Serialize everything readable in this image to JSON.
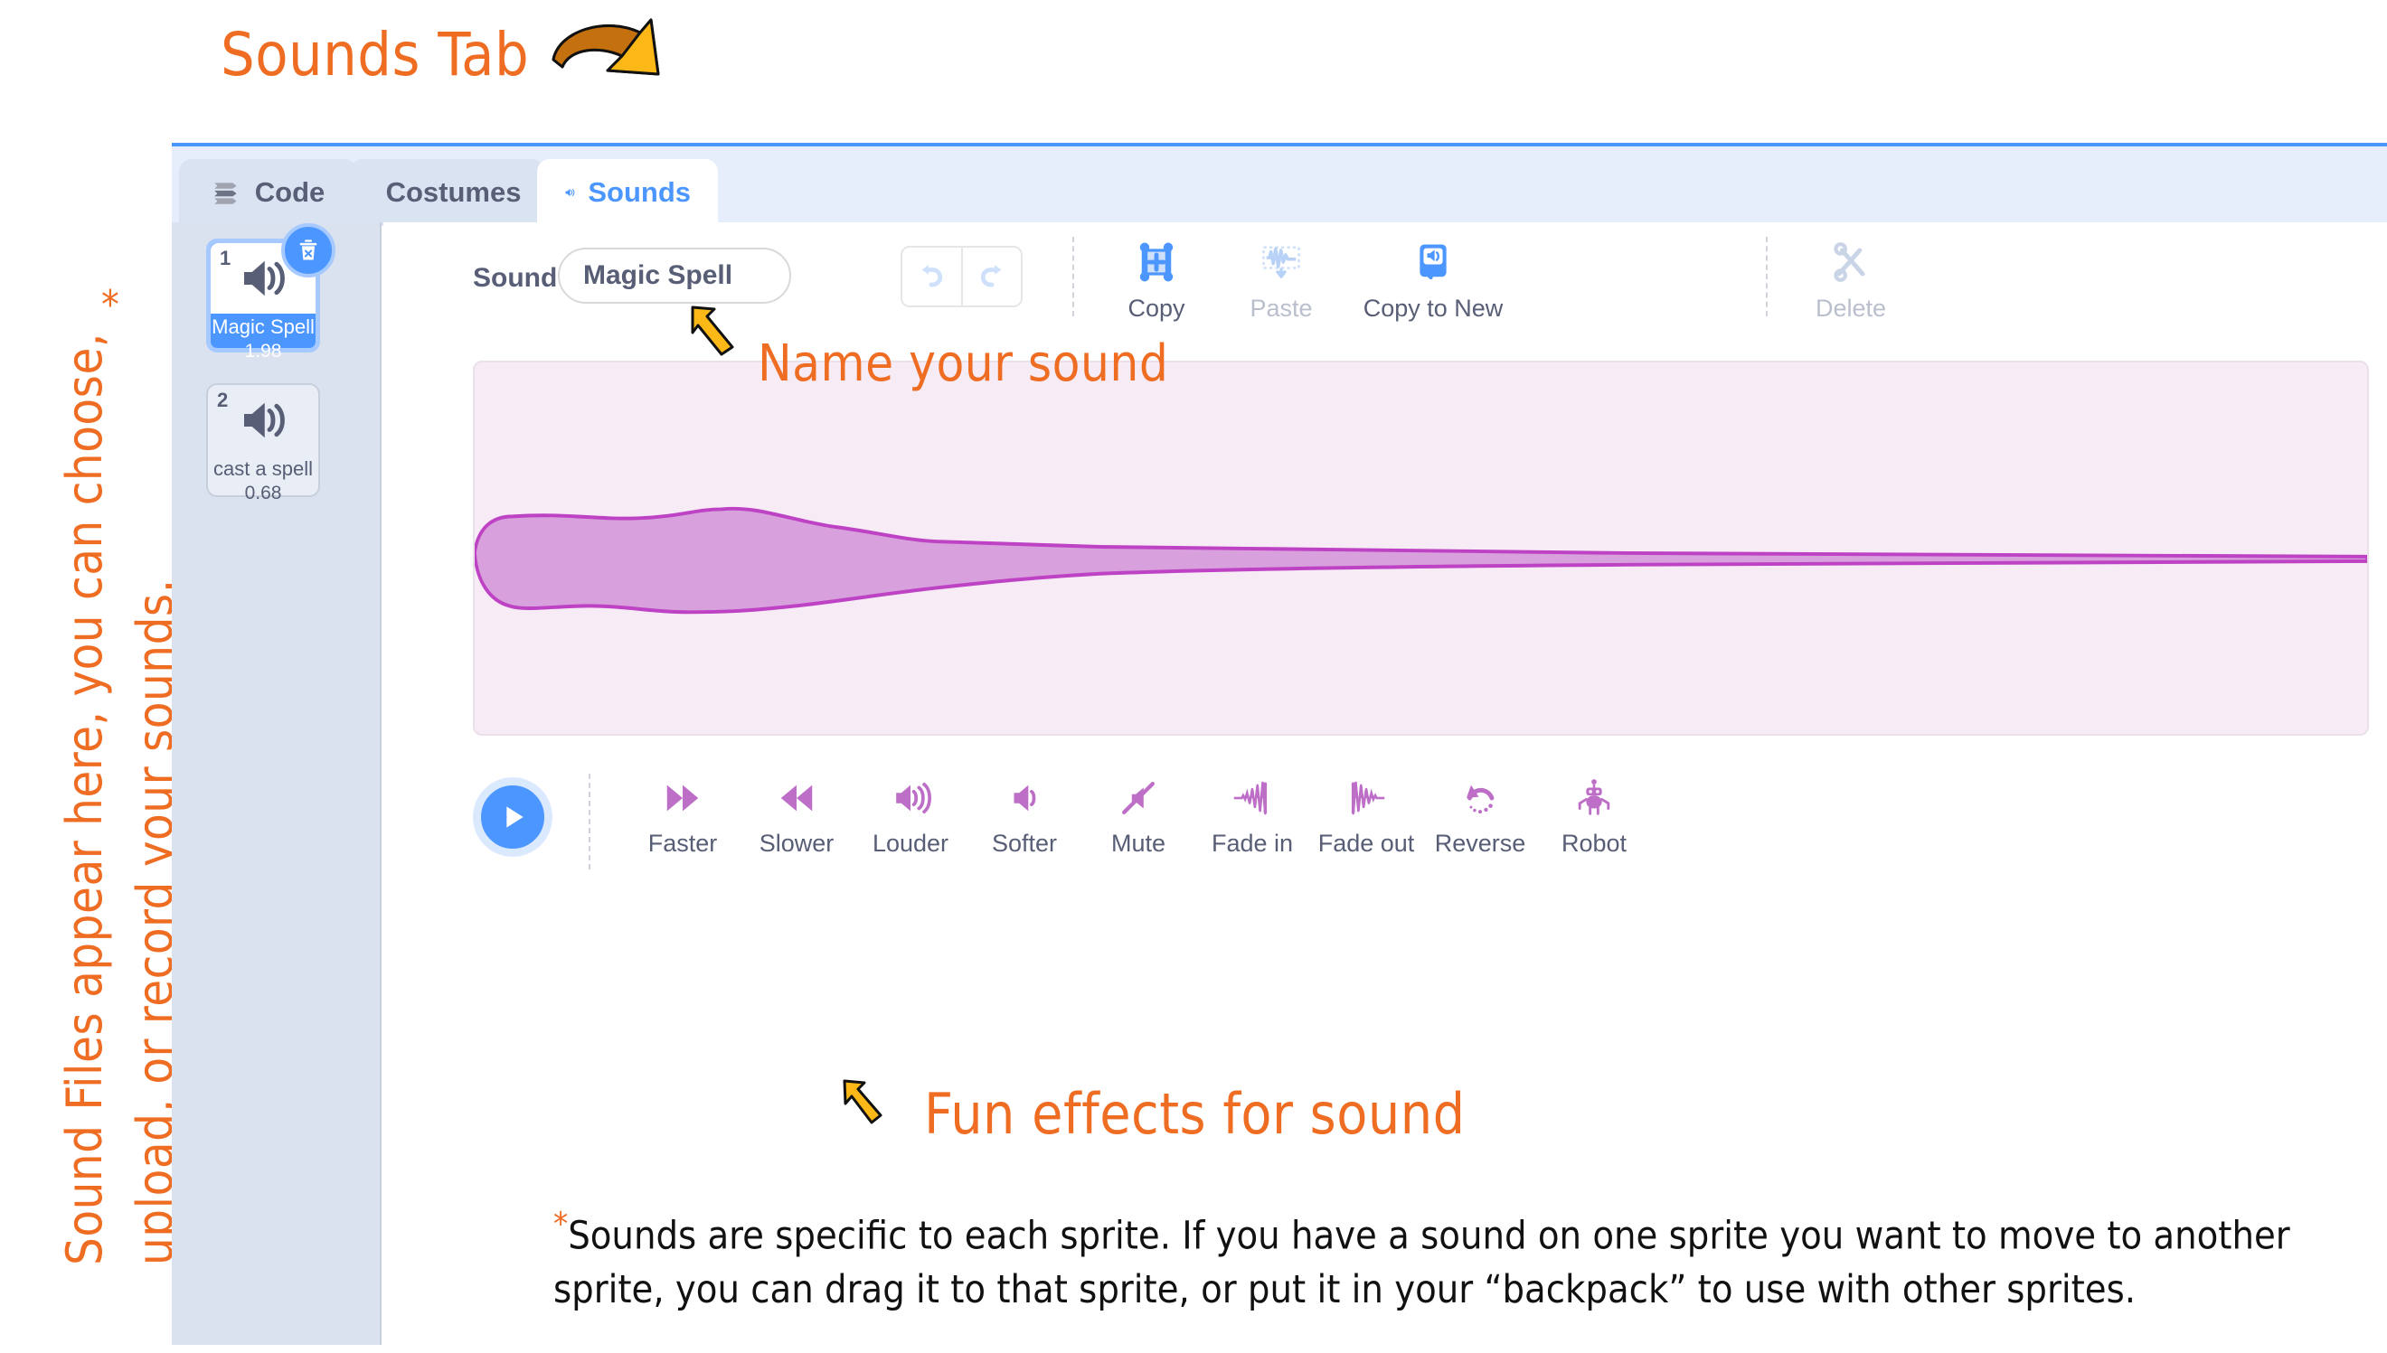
{
  "annotations": {
    "sounds_tab": "Sounds Tab",
    "name_your_sound": "Name your sound",
    "fun_effects": "Fun effects for sound",
    "sidebar_line1": "Sound Files appear here, you can choose,",
    "sidebar_line2": "upload, or record your sounds.",
    "sidebar_star": "*",
    "footnote_star": "*",
    "footnote": "Sounds are specific to each sprite. If you have a sound on one sprite you want to move to another sprite, you can drag it to that sprite, or put it in your “backpack” to use with other sprites.",
    "accent_color": "#ef6c23",
    "arrow_color": "#fbb817"
  },
  "tabs": [
    {
      "id": "code",
      "label": "Code",
      "icon": "code-blocks-icon",
      "active": false
    },
    {
      "id": "costumes",
      "label": "Costumes",
      "icon": "paintbrush-icon",
      "active": false
    },
    {
      "id": "sounds",
      "label": "Sounds",
      "icon": "speaker-icon",
      "active": true
    }
  ],
  "selector": {
    "sounds": [
      {
        "index": "1",
        "name": "Magic Spell",
        "duration": "1.98",
        "selected": true,
        "icon": "speaker-icon",
        "delete_badge": "trash-icon"
      },
      {
        "index": "2",
        "name": "cast a spell",
        "duration": "0.68",
        "selected": false,
        "icon": "speaker-icon"
      }
    ]
  },
  "toolbar": {
    "sound_label": "Sound",
    "sound_name_value": "Magic Spell",
    "undo_label": "undo-icon",
    "redo_label": "redo-icon",
    "buttons": [
      {
        "id": "copy",
        "label": "Copy",
        "icon": "copy-selection-icon",
        "enabled": true
      },
      {
        "id": "paste",
        "label": "Paste",
        "icon": "paste-waveform-icon",
        "enabled": false
      },
      {
        "id": "copy-to-new",
        "label": "Copy to New",
        "icon": "copy-to-new-sound-icon",
        "enabled": true
      },
      {
        "id": "delete",
        "label": "Delete",
        "icon": "scissors-icon",
        "enabled": false
      }
    ]
  },
  "waveform": {
    "fill_color": "#d8a0dd",
    "stroke_color": "#bd42c4",
    "background_color": "#f7ebf6"
  },
  "effects": {
    "play_label": "play-icon",
    "items": [
      {
        "id": "faster",
        "label": "Faster",
        "icon": "fast-forward-icon"
      },
      {
        "id": "slower",
        "label": "Slower",
        "icon": "rewind-icon"
      },
      {
        "id": "louder",
        "label": "Louder",
        "icon": "volume-up-icon"
      },
      {
        "id": "softer",
        "label": "Softer",
        "icon": "volume-down-icon"
      },
      {
        "id": "mute",
        "label": "Mute",
        "icon": "volume-mute-icon"
      },
      {
        "id": "fade-in",
        "label": "Fade in",
        "icon": "fade-in-icon"
      },
      {
        "id": "fade-out",
        "label": "Fade out",
        "icon": "fade-out-icon"
      },
      {
        "id": "reverse",
        "label": "Reverse",
        "icon": "reverse-arrow-icon"
      },
      {
        "id": "robot",
        "label": "Robot",
        "icon": "robot-icon"
      }
    ]
  },
  "colors": {
    "scratch_blue": "#4c97ff",
    "tab_bar_bg": "#e6eefc",
    "selector_bg": "#dbe2ef",
    "text_gray": "#575e75"
  }
}
